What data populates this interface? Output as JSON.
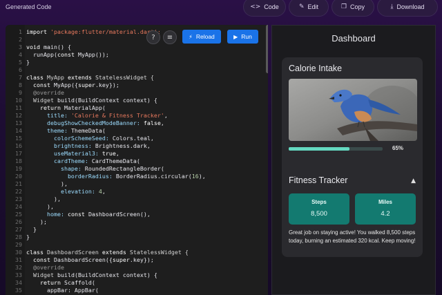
{
  "app_title": "Generated Code",
  "toolbar": {
    "code": {
      "icon": "code-icon",
      "label": "Code"
    },
    "edit": {
      "icon": "pencil-icon",
      "label": "Edit"
    },
    "copy": {
      "icon": "copy-icon",
      "label": "Copy"
    },
    "download": {
      "icon": "download-icon",
      "label": "Download"
    }
  },
  "editor": {
    "help_icon": "help-icon",
    "format_icon": "list-icon",
    "reload_label": "Reload",
    "run_label": "Run",
    "lines": [
      {
        "n": "1",
        "tokens": [
          [
            "import ",
            "kw"
          ],
          [
            "'package:flutter/material.dart';",
            "str"
          ]
        ]
      },
      {
        "n": "2",
        "tokens": []
      },
      {
        "n": "3",
        "tokens": [
          [
            "void ",
            "kw"
          ],
          [
            "main() {",
            "txt"
          ]
        ]
      },
      {
        "n": "4",
        "tokens": [
          [
            "  runApp(",
            "txt"
          ],
          [
            "const ",
            "kw"
          ],
          [
            "MyApp());",
            "txt"
          ]
        ]
      },
      {
        "n": "5",
        "tokens": [
          [
            "}",
            "txt"
          ]
        ]
      },
      {
        "n": "6",
        "tokens": []
      },
      {
        "n": "7",
        "tokens": [
          [
            "class ",
            "kw"
          ],
          [
            "MyApp ",
            "type"
          ],
          [
            "extends ",
            "kw"
          ],
          [
            "StatelessWidget {",
            "type"
          ]
        ]
      },
      {
        "n": "8",
        "tokens": [
          [
            "  ",
            "txt"
          ],
          [
            "const ",
            "kw"
          ],
          [
            "MyApp({",
            "txt"
          ],
          [
            "super",
            "kw"
          ],
          [
            ".key});",
            "txt"
          ]
        ]
      },
      {
        "n": "9",
        "tokens": [
          [
            "  @override",
            "at"
          ]
        ]
      },
      {
        "n": "10",
        "tokens": [
          [
            "  Widget ",
            "type"
          ],
          [
            "build(BuildContext context) {",
            "txt"
          ]
        ]
      },
      {
        "n": "11",
        "tokens": [
          [
            "    return ",
            "kw"
          ],
          [
            "MaterialApp(",
            "txt"
          ]
        ]
      },
      {
        "n": "12",
        "tokens": [
          [
            "      title: ",
            "prop"
          ],
          [
            "'Calorie & Fitness Tracker'",
            "str"
          ],
          [
            ",",
            "txt"
          ]
        ]
      },
      {
        "n": "13",
        "tokens": [
          [
            "      debugShowCheckedModeBanner: ",
            "prop"
          ],
          [
            "false",
            "kw"
          ],
          [
            ",",
            "txt"
          ]
        ]
      },
      {
        "n": "14",
        "tokens": [
          [
            "      theme: ",
            "prop"
          ],
          [
            "ThemeData(",
            "txt"
          ]
        ]
      },
      {
        "n": "15",
        "tokens": [
          [
            "        colorSchemeSeed: ",
            "prop"
          ],
          [
            "Colors.teal,",
            "txt"
          ]
        ]
      },
      {
        "n": "16",
        "tokens": [
          [
            "        brightness: ",
            "prop"
          ],
          [
            "Brightness.dark,",
            "txt"
          ]
        ]
      },
      {
        "n": "17",
        "tokens": [
          [
            "        useMaterial3: ",
            "prop"
          ],
          [
            "true",
            "kw"
          ],
          [
            ",",
            "txt"
          ]
        ]
      },
      {
        "n": "18",
        "tokens": [
          [
            "        cardTheme: ",
            "prop"
          ],
          [
            "CardThemeData(",
            "txt"
          ]
        ]
      },
      {
        "n": "19",
        "tokens": [
          [
            "          shape: ",
            "prop"
          ],
          [
            "RoundedRectangleBorder(",
            "txt"
          ]
        ]
      },
      {
        "n": "20",
        "tokens": [
          [
            "            borderRadius: ",
            "prop"
          ],
          [
            "BorderRadius.circular(",
            "txt"
          ],
          [
            "16",
            "num"
          ],
          [
            "),",
            "txt"
          ]
        ]
      },
      {
        "n": "21",
        "tokens": [
          [
            "          ),",
            "txt"
          ]
        ]
      },
      {
        "n": "22",
        "tokens": [
          [
            "          elevation: ",
            "prop"
          ],
          [
            "4",
            "num"
          ],
          [
            ",",
            "txt"
          ]
        ]
      },
      {
        "n": "23",
        "tokens": [
          [
            "        ),",
            "txt"
          ]
        ]
      },
      {
        "n": "24",
        "tokens": [
          [
            "      ),",
            "txt"
          ]
        ]
      },
      {
        "n": "25",
        "tokens": [
          [
            "      home: ",
            "prop"
          ],
          [
            "const ",
            "kw"
          ],
          [
            "DashboardScreen(),",
            "txt"
          ]
        ]
      },
      {
        "n": "26",
        "tokens": [
          [
            "    );",
            "txt"
          ]
        ]
      },
      {
        "n": "27",
        "tokens": [
          [
            "  }",
            "txt"
          ]
        ]
      },
      {
        "n": "28",
        "tokens": [
          [
            "}",
            "txt"
          ]
        ]
      },
      {
        "n": "29",
        "tokens": []
      },
      {
        "n": "30",
        "tokens": [
          [
            "class ",
            "kw"
          ],
          [
            "DashboardScreen ",
            "type"
          ],
          [
            "extends ",
            "kw"
          ],
          [
            "StatelessWidget {",
            "type"
          ]
        ]
      },
      {
        "n": "31",
        "tokens": [
          [
            "  ",
            "txt"
          ],
          [
            "const ",
            "kw"
          ],
          [
            "DashboardScreen({",
            "txt"
          ],
          [
            "super",
            "kw"
          ],
          [
            ".key});",
            "txt"
          ]
        ]
      },
      {
        "n": "32",
        "tokens": [
          [
            "  @override",
            "at"
          ]
        ]
      },
      {
        "n": "33",
        "tokens": [
          [
            "  Widget ",
            "type"
          ],
          [
            "build(BuildContext context) {",
            "txt"
          ]
        ]
      },
      {
        "n": "34",
        "tokens": [
          [
            "    return ",
            "kw"
          ],
          [
            "Scaffold(",
            "txt"
          ]
        ]
      },
      {
        "n": "35",
        "tokens": [
          [
            "      appBar: AppBar(",
            "txt"
          ]
        ]
      }
    ]
  },
  "preview": {
    "title": "Dashboard",
    "calorie_card": {
      "title": "Calorie Intake",
      "image": "bird-photo",
      "progress": 0.65,
      "progress_label": "65%"
    },
    "fitness_card": {
      "title": "Fitness Tracker",
      "collapse_icon": "chevron-up-icon",
      "stats": [
        {
          "label": "Steps",
          "value": "8,500"
        },
        {
          "label": "Miles",
          "value": "4.2"
        }
      ],
      "summary": "Great job on staying active! You walked 8,500 steps today, burning an estimated 320 kcal. Keep moving!"
    }
  },
  "colors": {
    "accent": "#1a73e8",
    "teal": "#137a70",
    "progress": "#64d8c0",
    "background": "#1d0d33"
  }
}
